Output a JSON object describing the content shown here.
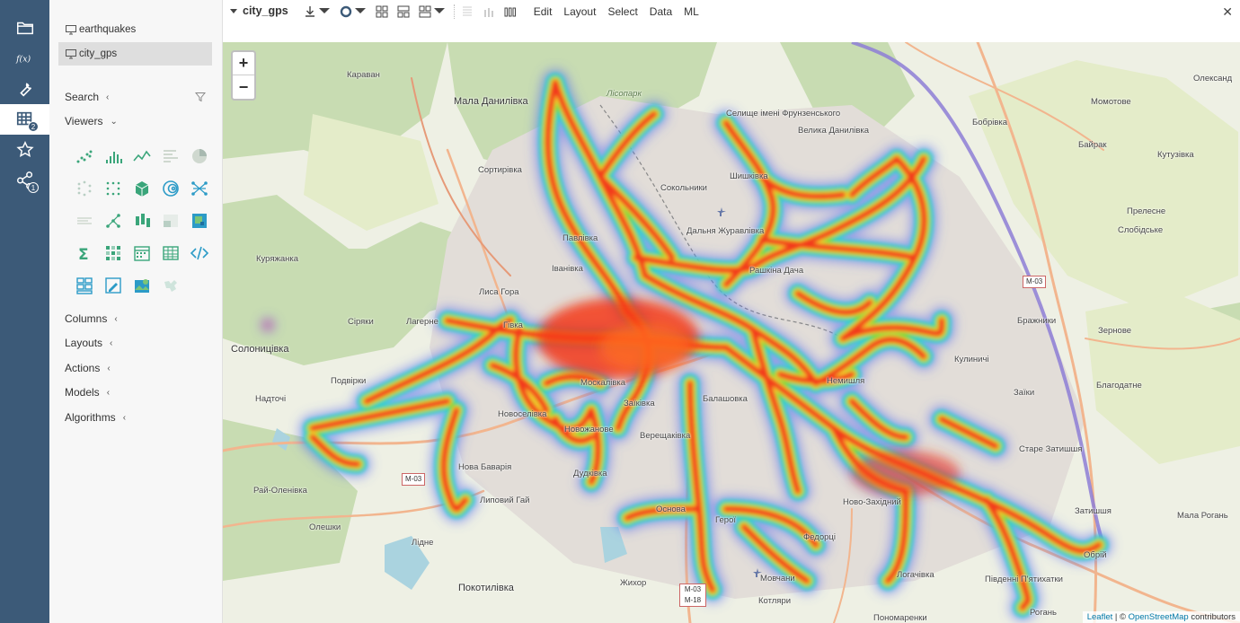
{
  "rail": {
    "items": [
      {
        "name": "open-icon",
        "badge": ""
      },
      {
        "name": "functions-icon",
        "badge": ""
      },
      {
        "name": "tools-icon",
        "badge": ""
      },
      {
        "name": "tables-icon",
        "badge": "2"
      },
      {
        "name": "favorites-icon",
        "badge": ""
      },
      {
        "name": "share-icon",
        "badge": "1"
      }
    ]
  },
  "panel": {
    "tables": [
      {
        "label": "earthquakes",
        "selected": false
      },
      {
        "label": "city_gps",
        "selected": true
      }
    ],
    "sections": {
      "search": "Search",
      "viewers": "Viewers",
      "columns": "Columns",
      "layouts": "Layouts",
      "actions": "Actions",
      "models": "Models",
      "algorithms": "Algorithms"
    },
    "viewer_icons": [
      "scatter-plot-icon",
      "histogram-icon",
      "line-chart-icon",
      "bar-chart-icon",
      "pie-chart-icon",
      "sankey-icon",
      "matrix-plot-icon",
      "3d-scatter-icon",
      "density-plot-icon",
      "network-icon",
      "parallel-coordinates-icon",
      "tree-icon",
      "box-plot-icon",
      "tile-icon",
      "heatmap-icon",
      "statistics-icon",
      "correlation-icon",
      "calendar-icon",
      "grid-icon",
      "markup-icon",
      "pivot-icon",
      "form-icon",
      "map-icon",
      "globe-icon"
    ]
  },
  "toolbar": {
    "title": "city_gps",
    "menus": [
      "Edit",
      "Layout",
      "Select",
      "Data",
      "ML"
    ],
    "close": "✕"
  },
  "map": {
    "zoom_in": "+",
    "zoom_out": "−",
    "attribution_leaflet": "Leaflet",
    "attribution_sep": " | © ",
    "attribution_osm": "OpenStreetMap",
    "attribution_tail": " contributors",
    "places": [
      "Караван",
      "Мала Данилівка",
      "Лісопарк",
      "Селище імені Фрунзенського",
      "Велика Данилівка",
      "Бобрівка",
      "Момотове",
      "Олександ",
      "Байрак",
      "Кутузівка",
      "Сортирівка",
      "Сокольники",
      "Шишківка",
      "Дальня Журавлівка",
      "Павлівка",
      "Іванівка",
      "Рашкіна Дача",
      "Куряжанка",
      "Лиса Гора",
      "Прелесне",
      "Слобідське",
      "Сіряки",
      "Лагерне",
      "Гівка",
      "Солоницівка",
      "Бражники",
      "Зернове",
      "Кулиничі",
      "Подвірки",
      "Надточі",
      "Москалівка",
      "Немишля",
      "Заїки",
      "Благодатне",
      "Новоселівка",
      "Заїківка",
      "Балашовка",
      "Новожанове",
      "Верещаківка",
      "Старе Затишшя",
      "Нова Баварія",
      "Дудківка",
      "Рай-Оленівка",
      "Липовий Гай",
      "Основа",
      "Ново-Західний",
      "Затишшя",
      "Мала Рогань",
      "Олешки",
      "Лідне",
      "Федорці",
      "Обрій",
      "Покотилівка",
      "Жихор",
      "Мовчани",
      "Котляри",
      "Логачівка",
      "Південні П'ятихатки",
      "Рогань",
      "Пономаренки",
      "Герої"
    ],
    "shields": [
      "М-03",
      "М-03",
      "М-03 М-18"
    ]
  }
}
